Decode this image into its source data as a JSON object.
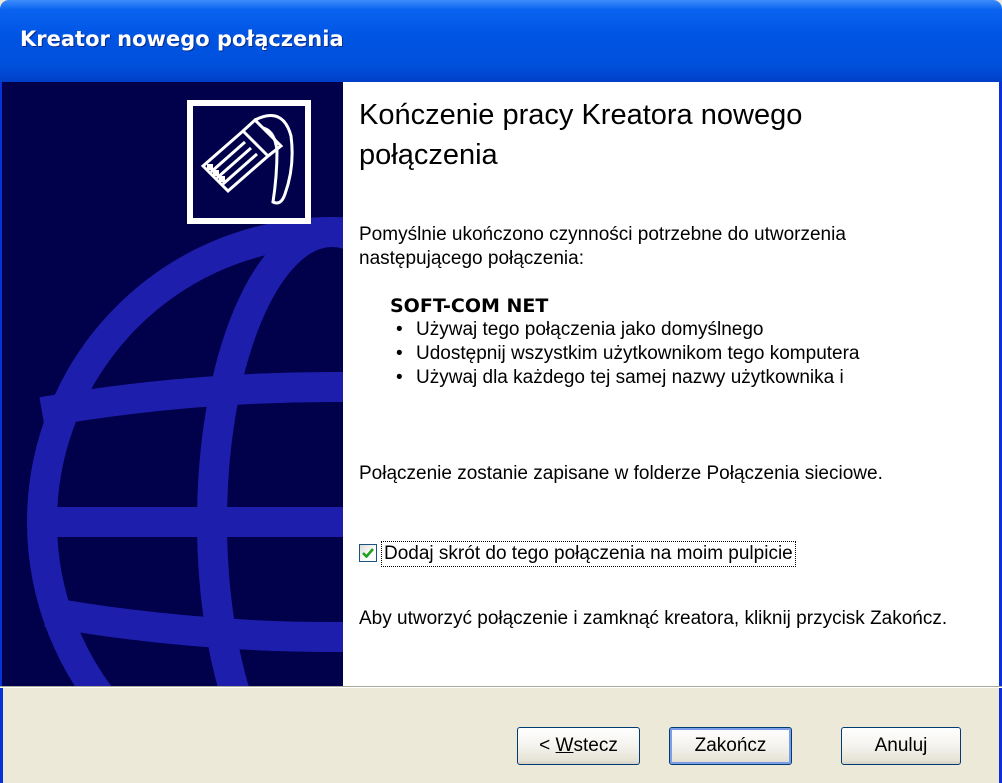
{
  "window": {
    "title": "Kreator nowego połączenia"
  },
  "icons": {
    "wizard": "network-cable-icon",
    "check": "checkmark-icon"
  },
  "content": {
    "heading": "Kończenie pracy Kreatora nowego połączenia",
    "intro": "Pomyślnie ukończono czynności potrzebne do utworzenia następującego połączenia:",
    "connection_name": "SOFT-COM NET",
    "options": [
      "Używaj tego połączenia jako domyślnego",
      "Udostępnij wszystkim użytkownikom tego komputera",
      "Używaj dla każdego tej samej nazwy użytkownika i"
    ],
    "save_note": "Połączenie zostanie zapisane w folderze Połączenia sieciowe.",
    "checkbox": {
      "label": "Dodaj skrót do tego połączenia na moim pulpicie",
      "checked": true
    },
    "finish_note": "Aby utworzyć połączenie i zamknąć kreatora, kliknij przycisk Zakończ."
  },
  "buttons": {
    "back_prefix": "< ",
    "back_mnemonic": "W",
    "back_rest": "stecz",
    "finish": "Zakończ",
    "cancel": "Anuluj"
  },
  "colors": {
    "title_bar": "#0054e3",
    "left_panel": "#00004b",
    "globe": "#1a1aa8",
    "face": "#ece9d8"
  }
}
